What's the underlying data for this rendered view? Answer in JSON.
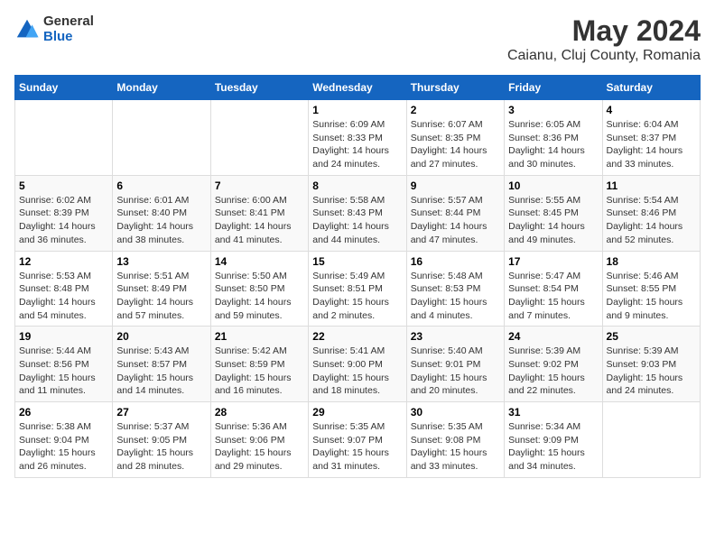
{
  "app": {
    "name_general": "General",
    "name_blue": "Blue"
  },
  "title": "May 2024",
  "location": "Caianu, Cluj County, Romania",
  "days_of_week": [
    "Sunday",
    "Monday",
    "Tuesday",
    "Wednesday",
    "Thursday",
    "Friday",
    "Saturday"
  ],
  "weeks": [
    [
      {
        "day": "",
        "content": ""
      },
      {
        "day": "",
        "content": ""
      },
      {
        "day": "",
        "content": ""
      },
      {
        "day": "1",
        "content": "Sunrise: 6:09 AM\nSunset: 8:33 PM\nDaylight: 14 hours\nand 24 minutes."
      },
      {
        "day": "2",
        "content": "Sunrise: 6:07 AM\nSunset: 8:35 PM\nDaylight: 14 hours\nand 27 minutes."
      },
      {
        "day": "3",
        "content": "Sunrise: 6:05 AM\nSunset: 8:36 PM\nDaylight: 14 hours\nand 30 minutes."
      },
      {
        "day": "4",
        "content": "Sunrise: 6:04 AM\nSunset: 8:37 PM\nDaylight: 14 hours\nand 33 minutes."
      }
    ],
    [
      {
        "day": "5",
        "content": "Sunrise: 6:02 AM\nSunset: 8:39 PM\nDaylight: 14 hours\nand 36 minutes."
      },
      {
        "day": "6",
        "content": "Sunrise: 6:01 AM\nSunset: 8:40 PM\nDaylight: 14 hours\nand 38 minutes."
      },
      {
        "day": "7",
        "content": "Sunrise: 6:00 AM\nSunset: 8:41 PM\nDaylight: 14 hours\nand 41 minutes."
      },
      {
        "day": "8",
        "content": "Sunrise: 5:58 AM\nSunset: 8:43 PM\nDaylight: 14 hours\nand 44 minutes."
      },
      {
        "day": "9",
        "content": "Sunrise: 5:57 AM\nSunset: 8:44 PM\nDaylight: 14 hours\nand 47 minutes."
      },
      {
        "day": "10",
        "content": "Sunrise: 5:55 AM\nSunset: 8:45 PM\nDaylight: 14 hours\nand 49 minutes."
      },
      {
        "day": "11",
        "content": "Sunrise: 5:54 AM\nSunset: 8:46 PM\nDaylight: 14 hours\nand 52 minutes."
      }
    ],
    [
      {
        "day": "12",
        "content": "Sunrise: 5:53 AM\nSunset: 8:48 PM\nDaylight: 14 hours\nand 54 minutes."
      },
      {
        "day": "13",
        "content": "Sunrise: 5:51 AM\nSunset: 8:49 PM\nDaylight: 14 hours\nand 57 minutes."
      },
      {
        "day": "14",
        "content": "Sunrise: 5:50 AM\nSunset: 8:50 PM\nDaylight: 14 hours\nand 59 minutes."
      },
      {
        "day": "15",
        "content": "Sunrise: 5:49 AM\nSunset: 8:51 PM\nDaylight: 15 hours\nand 2 minutes."
      },
      {
        "day": "16",
        "content": "Sunrise: 5:48 AM\nSunset: 8:53 PM\nDaylight: 15 hours\nand 4 minutes."
      },
      {
        "day": "17",
        "content": "Sunrise: 5:47 AM\nSunset: 8:54 PM\nDaylight: 15 hours\nand 7 minutes."
      },
      {
        "day": "18",
        "content": "Sunrise: 5:46 AM\nSunset: 8:55 PM\nDaylight: 15 hours\nand 9 minutes."
      }
    ],
    [
      {
        "day": "19",
        "content": "Sunrise: 5:44 AM\nSunset: 8:56 PM\nDaylight: 15 hours\nand 11 minutes."
      },
      {
        "day": "20",
        "content": "Sunrise: 5:43 AM\nSunset: 8:57 PM\nDaylight: 15 hours\nand 14 minutes."
      },
      {
        "day": "21",
        "content": "Sunrise: 5:42 AM\nSunset: 8:59 PM\nDaylight: 15 hours\nand 16 minutes."
      },
      {
        "day": "22",
        "content": "Sunrise: 5:41 AM\nSunset: 9:00 PM\nDaylight: 15 hours\nand 18 minutes."
      },
      {
        "day": "23",
        "content": "Sunrise: 5:40 AM\nSunset: 9:01 PM\nDaylight: 15 hours\nand 20 minutes."
      },
      {
        "day": "24",
        "content": "Sunrise: 5:39 AM\nSunset: 9:02 PM\nDaylight: 15 hours\nand 22 minutes."
      },
      {
        "day": "25",
        "content": "Sunrise: 5:39 AM\nSunset: 9:03 PM\nDaylight: 15 hours\nand 24 minutes."
      }
    ],
    [
      {
        "day": "26",
        "content": "Sunrise: 5:38 AM\nSunset: 9:04 PM\nDaylight: 15 hours\nand 26 minutes."
      },
      {
        "day": "27",
        "content": "Sunrise: 5:37 AM\nSunset: 9:05 PM\nDaylight: 15 hours\nand 28 minutes."
      },
      {
        "day": "28",
        "content": "Sunrise: 5:36 AM\nSunset: 9:06 PM\nDaylight: 15 hours\nand 29 minutes."
      },
      {
        "day": "29",
        "content": "Sunrise: 5:35 AM\nSunset: 9:07 PM\nDaylight: 15 hours\nand 31 minutes."
      },
      {
        "day": "30",
        "content": "Sunrise: 5:35 AM\nSunset: 9:08 PM\nDaylight: 15 hours\nand 33 minutes."
      },
      {
        "day": "31",
        "content": "Sunrise: 5:34 AM\nSunset: 9:09 PM\nDaylight: 15 hours\nand 34 minutes."
      },
      {
        "day": "",
        "content": ""
      }
    ]
  ]
}
